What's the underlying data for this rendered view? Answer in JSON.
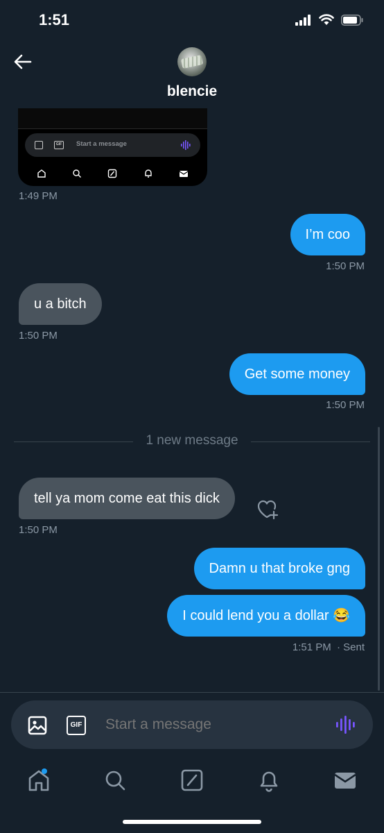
{
  "status_bar": {
    "time": "1:51"
  },
  "header": {
    "contact_name": "blencie"
  },
  "attached_screenshot": {
    "composer_placeholder": "Start a message",
    "gif_label": "GIF"
  },
  "messages": [
    {
      "side": "in",
      "type": "image",
      "timestamp": "1:49 PM"
    },
    {
      "side": "out",
      "text": "I’m coo",
      "timestamp": "1:50 PM"
    },
    {
      "side": "in",
      "text": "u a bitch",
      "timestamp": "1:50 PM"
    },
    {
      "side": "out",
      "text": "Get some money",
      "timestamp": "1:50 PM"
    },
    {
      "side": "in",
      "text": "tell ya mom come eat this dick",
      "timestamp": "1:50 PM"
    },
    {
      "side": "out",
      "text": "Damn u that broke gng"
    },
    {
      "side": "out",
      "text": "I could lend you a dollar 😂",
      "timestamp": "1:51 PM",
      "status": "· Sent"
    }
  ],
  "new_message_divider": "1 new message",
  "composer": {
    "placeholder": "Start a message",
    "gif_label": "GIF"
  },
  "tabbar": {
    "items": [
      "home-icon",
      "search-icon",
      "grok-icon",
      "notifications-icon",
      "messages-icon"
    ],
    "home_badge": true
  },
  "colors": {
    "background": "#15202b",
    "outgoing_bubble": "#1d9bf0",
    "incoming_bubble": "#4a545d",
    "accent_voice": "#7856ff"
  }
}
